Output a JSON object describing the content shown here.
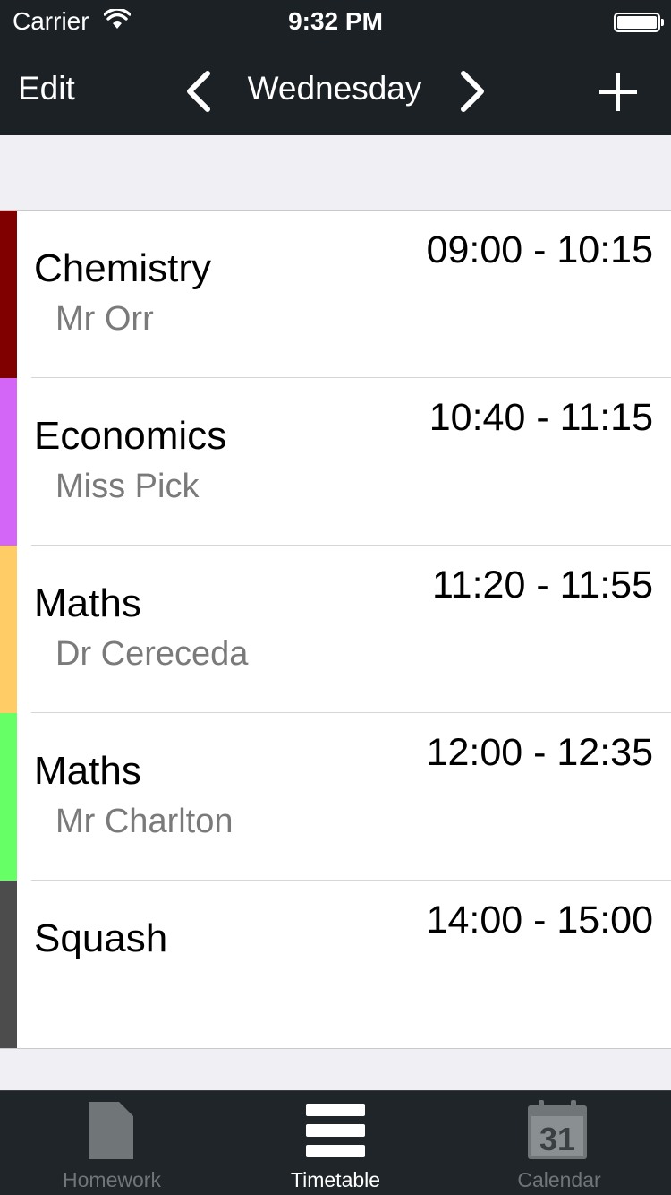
{
  "status_bar": {
    "carrier": "Carrier",
    "time": "9:32 PM"
  },
  "nav_bar": {
    "edit_label": "Edit",
    "title": "Wednesday",
    "prev_icon": "chevron-left-icon",
    "next_icon": "chevron-right-icon",
    "add_icon": "plus-icon"
  },
  "lessons": [
    {
      "subject": "Chemistry",
      "teacher": "Mr Orr",
      "time": "09:00 - 10:15",
      "color": "#800000"
    },
    {
      "subject": "Economics",
      "teacher": "Miss Pick",
      "time": "10:40 - 11:15",
      "color": "#d466f7"
    },
    {
      "subject": "Maths",
      "teacher": "Dr Cereceda",
      "time": "11:20 - 11:55",
      "color": "#ffcc66"
    },
    {
      "subject": "Maths",
      "teacher": "Mr Charlton",
      "time": "12:00 - 12:35",
      "color": "#66ff66"
    },
    {
      "subject": "Squash",
      "teacher": "",
      "time": "14:00 - 15:00",
      "color": "#4c4c4c"
    }
  ],
  "tab_bar": {
    "tabs": [
      {
        "label": "Homework",
        "icon": "document-icon",
        "selected": false
      },
      {
        "label": "Timetable",
        "icon": "list-icon",
        "selected": true
      },
      {
        "label": "Calendar",
        "icon": "calendar-icon",
        "selected": false,
        "icon_text": "31"
      }
    ]
  },
  "colors": {
    "bar_background": "#1b2124",
    "page_background": "#efeff4",
    "inactive_tab": "#707577"
  }
}
